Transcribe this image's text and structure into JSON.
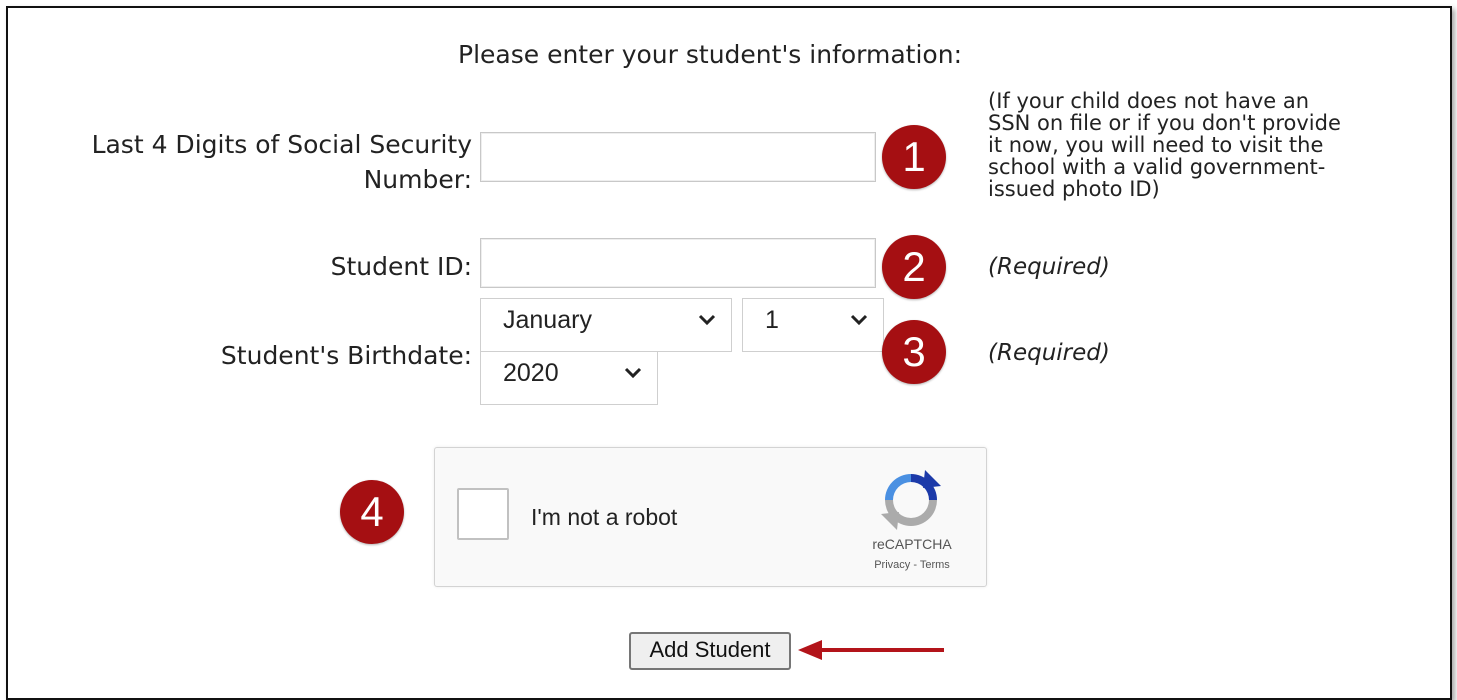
{
  "form": {
    "heading": "Please enter your student's information:",
    "ssn_label_line1": "Last 4 Digits of Social Security",
    "ssn_label_line2": "Number:",
    "ssn_value": "",
    "ssn_note": [
      "(If your child does not have an",
      "SSN on file or if you don't provide",
      "it now, you will need to visit the",
      "school with a valid government-",
      "issued photo ID)"
    ],
    "student_id_label": "Student ID:",
    "student_id_value": "",
    "student_id_note": "(Required)",
    "birthdate_label": "Student's Birthdate:",
    "birth_month": "January",
    "birth_day": "1",
    "birth_year": "2020",
    "birthdate_note": "(Required)",
    "add_button": "Add Student"
  },
  "badges": [
    "1",
    "2",
    "3",
    "4"
  ],
  "captcha": {
    "label": "I'm not a robot",
    "brand": "reCAPTCHA",
    "links": "Privacy - Terms",
    "logo_icon": "recaptcha-logo-icon"
  },
  "colors": {
    "badge": "#a50f12",
    "arrow": "#b3141a"
  },
  "icons": [
    "chevron-down-icon",
    "recaptcha-logo-icon",
    "arrow-left-icon"
  ]
}
